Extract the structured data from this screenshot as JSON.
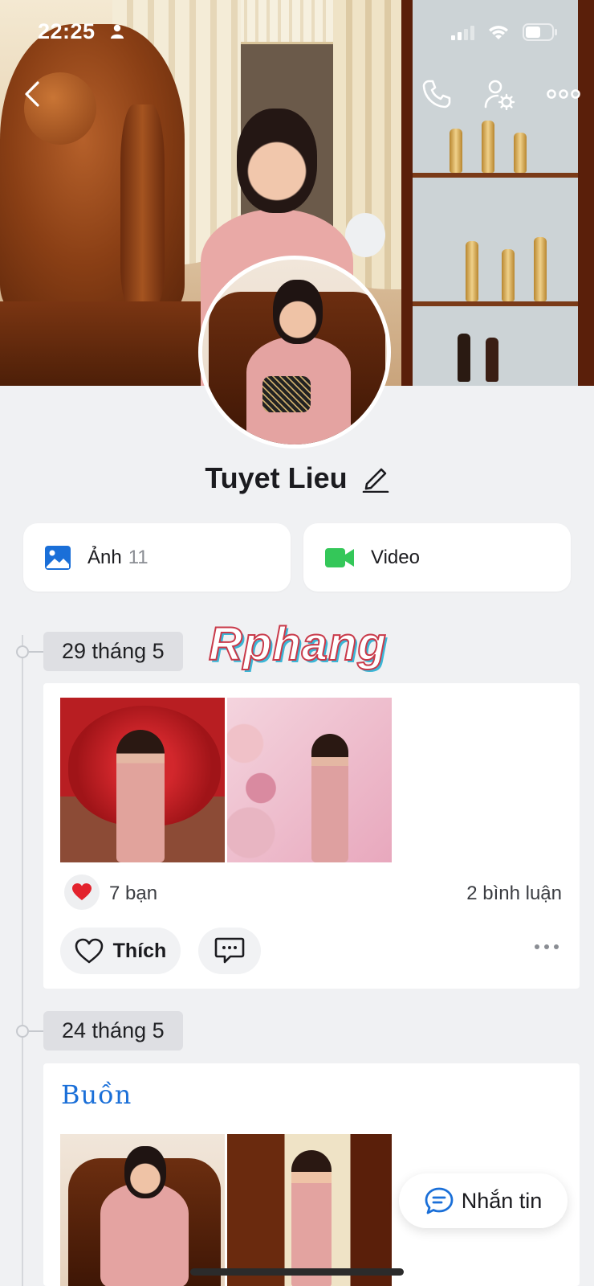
{
  "status": {
    "time": "22:25"
  },
  "profile": {
    "name": "Tuyet Lieu"
  },
  "media": {
    "photos_label": "Ảnh",
    "photos_count": "11",
    "video_label": "Video"
  },
  "watermark": "Rphang",
  "timeline": [
    {
      "date": "29 tháng 5",
      "likes": "7 bạn",
      "comments": "2 bình luận",
      "like_label": "Thích"
    },
    {
      "date": "24 tháng 5",
      "title": "Buồn"
    }
  ],
  "message_button": "Nhắn tin",
  "colors": {
    "accent": "#1a6fd8",
    "video_green": "#34c759",
    "heart_red": "#e3232d"
  },
  "icons": [
    "back-icon",
    "phone-icon",
    "profile-settings-icon",
    "more-icon",
    "edit-icon",
    "image-icon",
    "video-camera-icon",
    "heart-icon",
    "comment-icon",
    "chat-icon"
  ]
}
